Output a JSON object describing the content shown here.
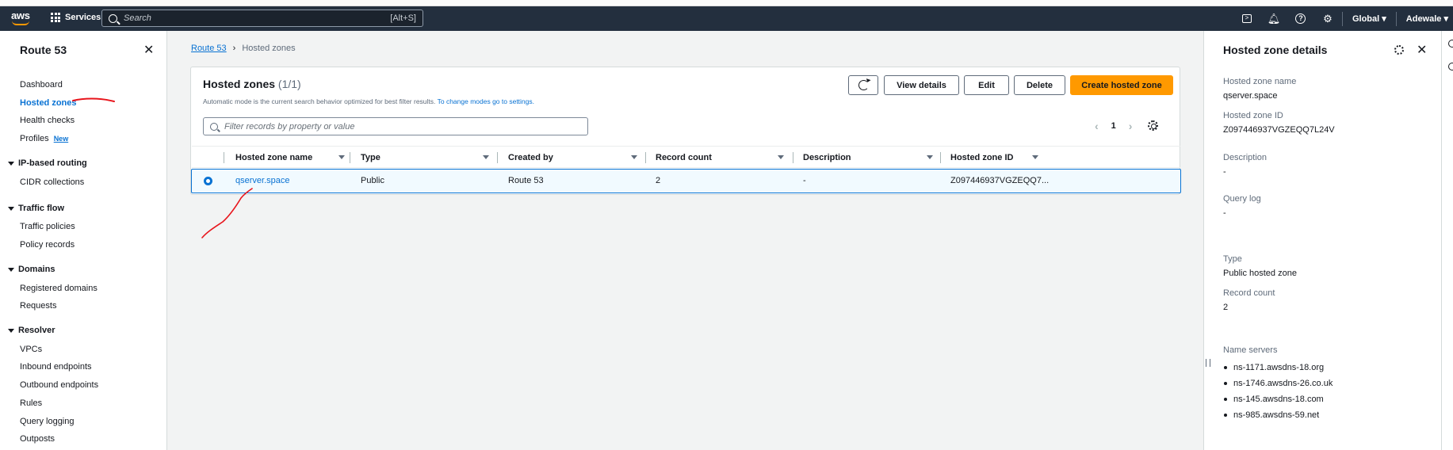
{
  "navbar": {
    "logo_text": "aws",
    "services_label": "Services",
    "search_placeholder": "Search",
    "search_shortcut": "[Alt+S]",
    "region": "Global ▾",
    "user": "Adewale ▾"
  },
  "sidebar": {
    "title": "Route 53",
    "items": {
      "dashboard": "Dashboard",
      "hosted_zones": "Hosted zones",
      "health_checks": "Health checks",
      "profiles": "Profiles",
      "profiles_badge": "New",
      "ip_routing": "IP-based routing",
      "cidr": "CIDR collections",
      "traffic_flow": "Traffic flow",
      "traffic_policies": "Traffic policies",
      "policy_records": "Policy records",
      "domains": "Domains",
      "registered_domains": "Registered domains",
      "requests": "Requests",
      "resolver": "Resolver",
      "vpcs": "VPCs",
      "inbound": "Inbound endpoints",
      "outbound": "Outbound endpoints",
      "rules": "Rules",
      "query_logging": "Query logging",
      "outposts": "Outposts"
    }
  },
  "breadcrumb": {
    "root": "Route 53",
    "current": "Hosted zones"
  },
  "panel": {
    "title": "Hosted zones",
    "count": "(1/1)",
    "description": "Automatic mode is the current search behavior optimized for best filter results.",
    "description_link": "To change modes go to settings.",
    "buttons": {
      "view_details": "View details",
      "edit": "Edit",
      "delete": "Delete",
      "create": "Create hosted zone"
    },
    "filter_placeholder": "Filter records by property or value",
    "page": "1"
  },
  "table": {
    "columns": {
      "name": "Hosted zone name",
      "type": "Type",
      "created_by": "Created by",
      "record_count": "Record count",
      "description": "Description",
      "zone_id": "Hosted zone ID"
    },
    "rows": [
      {
        "name": "qserver.space",
        "type": "Public",
        "created_by": "Route 53",
        "record_count": "2",
        "description": "-",
        "zone_id": "Z097446937VGZEQQ7..."
      }
    ]
  },
  "details": {
    "title": "Hosted zone details",
    "name_label": "Hosted zone name",
    "name_value": "qserver.space",
    "id_label": "Hosted zone ID",
    "id_value": "Z097446937VGZEQQ7L24V",
    "desc_label": "Description",
    "desc_value": "-",
    "querylog_label": "Query log",
    "querylog_value": "-",
    "type_label": "Type",
    "type_value": "Public hosted zone",
    "count_label": "Record count",
    "count_value": "2",
    "ns_label": "Name servers",
    "name_servers": [
      "ns-1171.awsdns-18.org",
      "ns-1746.awsdns-26.co.uk",
      "ns-145.awsdns-18.com",
      "ns-985.awsdns-59.net"
    ]
  },
  "colors": {
    "navbar_bg": "#232f3e",
    "link": "#0972d3",
    "primary_button": "#ff9900",
    "annotation": "#e8141b"
  }
}
